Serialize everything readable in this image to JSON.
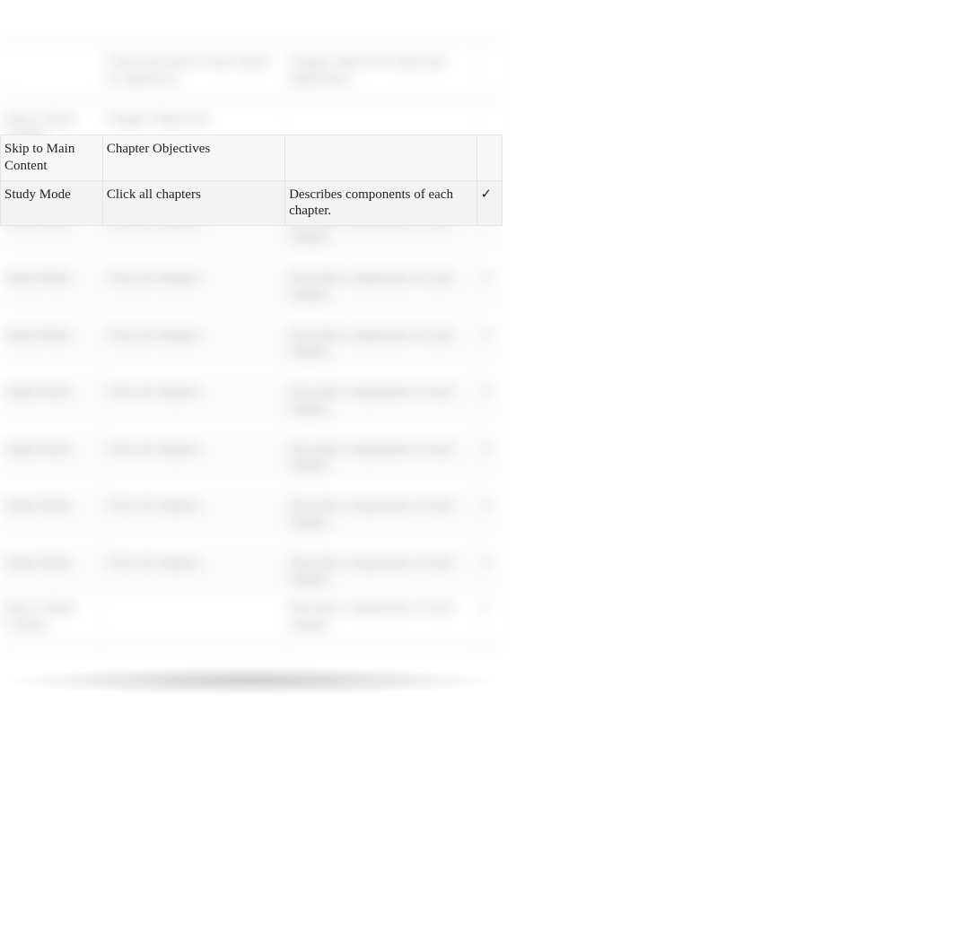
{
  "header": {
    "col2_header": "Click each item to learn about its objectives.",
    "col3_header": "Chapter objectives listed and linked here."
  },
  "sharp_rows": [
    {
      "c1": "Skip to Main Content",
      "c2": "Chapter Objectives",
      "c3": "",
      "c4": ""
    },
    {
      "c1": "Study Mode",
      "c2": "Click all chapters",
      "c3": "Describes components of each chapter.",
      "c4": "✓"
    }
  ],
  "blur_rows": [
    {
      "c1": "",
      "c2": "",
      "c3": "",
      "c4": ""
    },
    {
      "c1": "",
      "c2": "Click each item to learn about its objectives.",
      "c3": "Chapter objectives listed and linked here.",
      "c4": ""
    },
    {
      "c1": "",
      "c2": "",
      "c3": "",
      "c4": ""
    },
    {
      "c1": "Skip to Main Content",
      "c2": "Chapter Objectives",
      "c3": "",
      "c4": ""
    },
    {
      "c1": "Study Mode",
      "c2": "Click all chapters",
      "c3": "Describes components of each chapter.",
      "c4": "✓"
    },
    {
      "c1": "",
      "c2": "",
      "c3": "",
      "c4": ""
    },
    {
      "c1": "Study Mode",
      "c2": "Click all chapters",
      "c3": "Describes components of each chapter.",
      "c4": "✓"
    },
    {
      "c1": "",
      "c2": "",
      "c3": "",
      "c4": ""
    },
    {
      "c1": "Study Mode",
      "c2": "Click all chapters",
      "c3": "Describes components of each chapter.",
      "c4": "✓"
    },
    {
      "c1": "",
      "c2": "",
      "c3": "",
      "c4": ""
    },
    {
      "c1": "Study Mode",
      "c2": "Click all chapters",
      "c3": "Describes components of each chapter.",
      "c4": "✓"
    },
    {
      "c1": "",
      "c2": "",
      "c3": "",
      "c4": ""
    },
    {
      "c1": "Study Mode",
      "c2": "Click all chapters",
      "c3": "Describes components of each chapter.",
      "c4": "✓"
    },
    {
      "c1": "",
      "c2": "",
      "c3": "",
      "c4": ""
    },
    {
      "c1": "Study Mode",
      "c2": "Click all chapters",
      "c3": "Describes components of each chapter.",
      "c4": "✓"
    },
    {
      "c1": "",
      "c2": "",
      "c3": "",
      "c4": ""
    },
    {
      "c1": "Study Mode",
      "c2": "Click all chapters",
      "c3": "Describes components of each chapter.",
      "c4": "✓"
    },
    {
      "c1": "",
      "c2": "",
      "c3": "",
      "c4": ""
    },
    {
      "c1": "Study Mode",
      "c2": "Click all chapters",
      "c3": "Describes components of each chapter.",
      "c4": "✓"
    },
    {
      "c1": "Skip to Main Content",
      "c2": "",
      "c3": "Describes components of each chapter.",
      "c4": "✓"
    },
    {
      "c1": "",
      "c2": "",
      "c3": "",
      "c4": ""
    }
  ]
}
